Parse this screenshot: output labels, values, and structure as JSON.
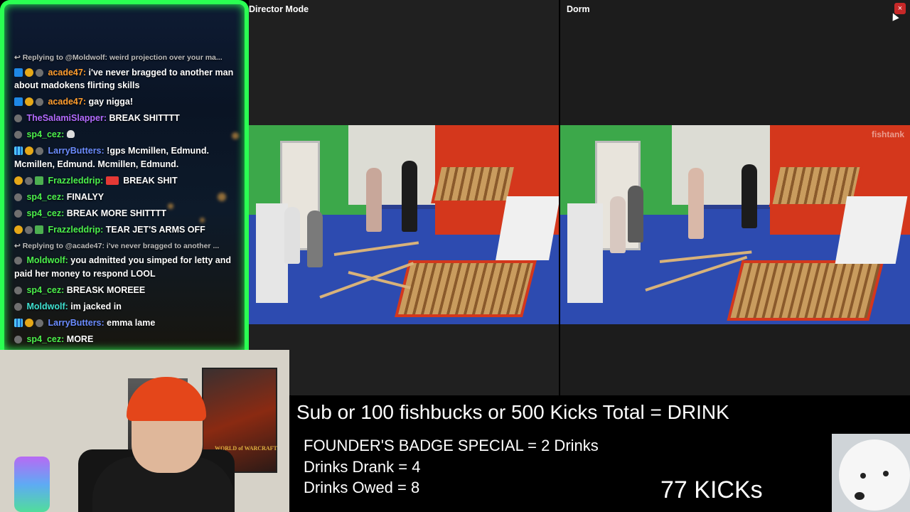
{
  "chat": {
    "messages": [
      {
        "type": "reply",
        "text": "Replying to @Moldwolf: weird projection over your ma..."
      },
      {
        "type": "msg",
        "user": "acade47",
        "text": "i've never bragged to another man about madokens flirting skills"
      },
      {
        "type": "msg",
        "user": "acade47",
        "text": "gay nigga!"
      },
      {
        "type": "msg",
        "user": "TheSalamiSlapper",
        "text": "BREAK SHITTTT"
      },
      {
        "type": "msg",
        "user": "sp4_cez",
        "text": ""
      },
      {
        "type": "msg",
        "user": "LarryButters",
        "text": "!gps Mcmillen, Edmund. Mcmillen, Edmund. Mcmillen, Edmund."
      },
      {
        "type": "msg",
        "user": "Frazzleddrip",
        "text": "BREAK SHIT"
      },
      {
        "type": "msg",
        "user": "sp4_cez",
        "text": "FINALYY"
      },
      {
        "type": "msg",
        "user": "sp4_cez",
        "text": "BREAK MORE SHITTTT"
      },
      {
        "type": "msg",
        "user": "Frazzleddrip",
        "text": "TEAR JET'S ARMS OFF"
      },
      {
        "type": "reply",
        "text": "Replying to @acade47: i've never bragged to another ..."
      },
      {
        "type": "msg",
        "user": "Moldwolf",
        "text": "you admitted you simped for letty and paid her money to respond LOOL"
      },
      {
        "type": "msg",
        "user": "sp4_cez",
        "text": "BREASK MOREEE"
      },
      {
        "type": "msg",
        "user": "Moldwolf",
        "text": "im jacked in"
      },
      {
        "type": "msg",
        "user": "LarryButters",
        "text": "emma lame"
      },
      {
        "type": "msg",
        "user": "sp4_cez",
        "text": "MORE"
      }
    ]
  },
  "panels": {
    "left_title": "Director Mode",
    "right_title": "Dorm",
    "close_label": "×",
    "watermark": "fishtank"
  },
  "webcam": {
    "poster_logo": "WORLD of WARCRAFT"
  },
  "info": {
    "headline": "Sub or 100 fishbucks or 500 Kicks Total = DRINK",
    "line1": "FOUNDER'S BADGE SPECIAL = 2 Drinks",
    "line2": "Drinks Drank = 4",
    "line3": "Drinks Owed = 8",
    "kicks": "77 KICKs"
  }
}
